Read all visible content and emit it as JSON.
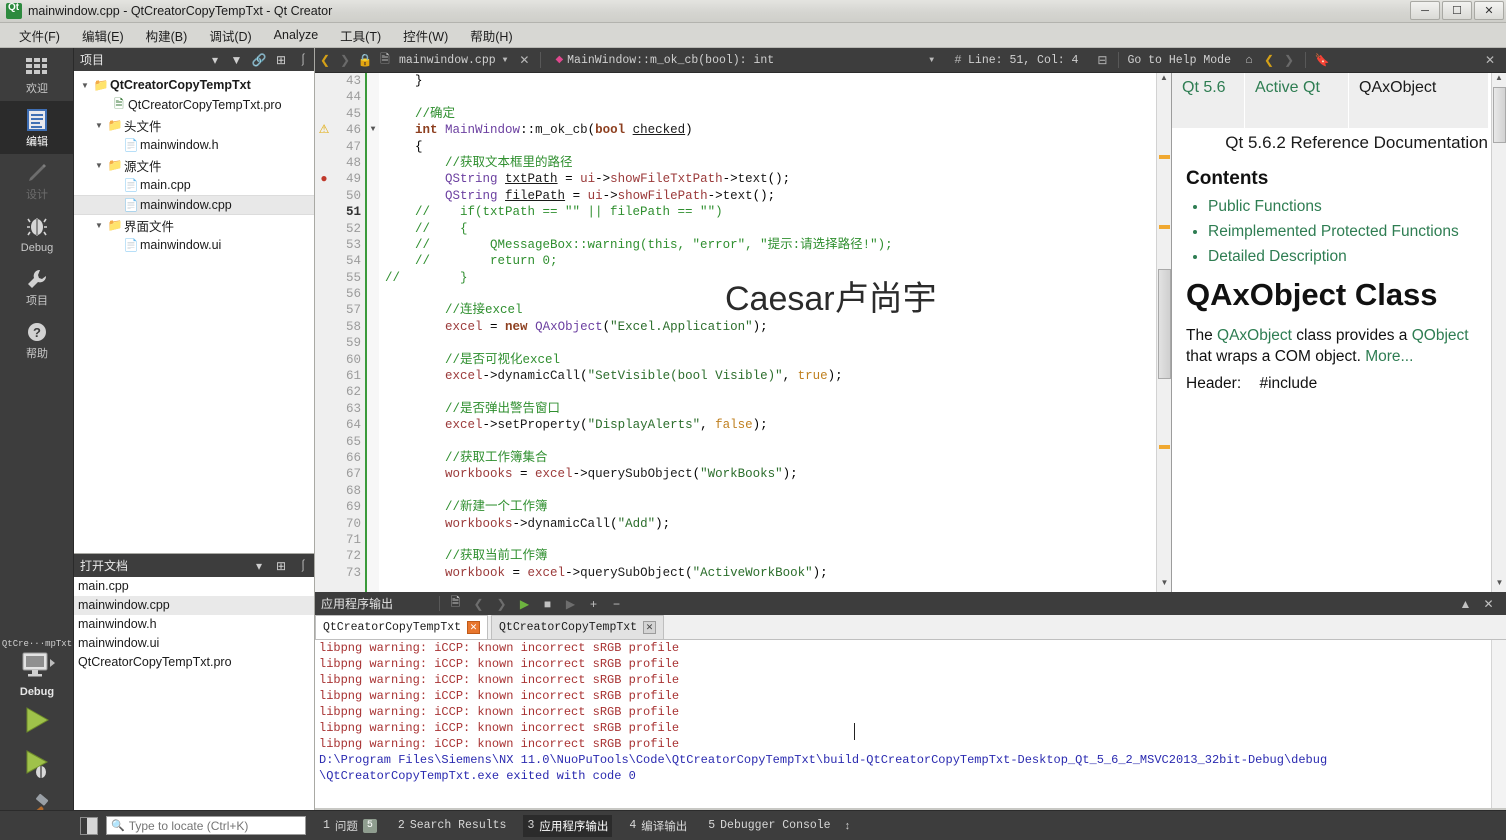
{
  "window": {
    "title": "mainwindow.cpp - QtCreatorCopyTempTxt - Qt Creator",
    "app_icon": "qt-logo-icon",
    "minimize_label": "–",
    "maximize_label": "❐",
    "close_label": "✕"
  },
  "menubar": {
    "items": [
      {
        "label": "文件(F)"
      },
      {
        "label": "编辑(E)"
      },
      {
        "label": "构建(B)"
      },
      {
        "label": "调试(D)"
      },
      {
        "label": "Analyze"
      },
      {
        "label": "工具(T)"
      },
      {
        "label": "控件(W)"
      },
      {
        "label": "帮助(H)"
      }
    ]
  },
  "modebar": {
    "items": [
      {
        "label": "欢迎",
        "icon": "welcome-grid-icon",
        "state": "normal"
      },
      {
        "label": "编辑",
        "icon": "edit-document-icon",
        "state": "selected"
      },
      {
        "label": "设计",
        "icon": "design-pencil-icon",
        "state": "disabled"
      },
      {
        "label": "Debug",
        "icon": "debug-bug-icon",
        "state": "normal"
      },
      {
        "label": "项目",
        "icon": "projects-wrench-icon",
        "state": "normal"
      },
      {
        "label": "帮助",
        "icon": "help-question-icon",
        "state": "normal"
      }
    ],
    "run_section": {
      "kit_name": "QtCre···mpTxt",
      "kit_config": "Debug",
      "kit_icon": "desktop-monitor-icon",
      "run_icon": "run-play-icon",
      "debug_icon": "debug-play-icon",
      "build_icon": "build-hammer-icon"
    }
  },
  "projects_panel": {
    "title": "项目",
    "header_icons": [
      "chevron-down-icon",
      "filter-icon",
      "link-sync-icon",
      "split-icon",
      "close-panel-icon"
    ],
    "tree": [
      {
        "label": "QtCreatorCopyTempTxt",
        "depth": 0,
        "arrow": "open",
        "icon": "project-folder-icon",
        "bold": true,
        "selected": false
      },
      {
        "label": "QtCreatorCopyTempTxt.pro",
        "depth": 1,
        "arrow": "none",
        "icon": "pro-file-icon",
        "bold": false,
        "selected": false
      },
      {
        "label": "头文件",
        "depth": 1,
        "arrow": "open",
        "icon": "header-folder-icon",
        "bold": false,
        "selected": false
      },
      {
        "label": "mainwindow.h",
        "depth": 2,
        "arrow": "none",
        "icon": "file-icon",
        "bold": false,
        "selected": false
      },
      {
        "label": "源文件",
        "depth": 1,
        "arrow": "open",
        "icon": "source-folder-icon",
        "bold": false,
        "selected": false
      },
      {
        "label": "main.cpp",
        "depth": 2,
        "arrow": "none",
        "icon": "file-icon",
        "bold": false,
        "selected": false
      },
      {
        "label": "mainwindow.cpp",
        "depth": 2,
        "arrow": "none",
        "icon": "file-icon",
        "bold": false,
        "selected": true
      },
      {
        "label": "界面文件",
        "depth": 1,
        "arrow": "open",
        "icon": "ui-folder-icon",
        "bold": false,
        "selected": false
      },
      {
        "label": "mainwindow.ui",
        "depth": 2,
        "arrow": "none",
        "icon": "ui-file-icon",
        "bold": false,
        "selected": false
      }
    ]
  },
  "open_documents": {
    "title": "打开文档",
    "header_icons": [
      "chevron-down-icon",
      "split-icon",
      "close-panel-icon"
    ],
    "items": [
      {
        "label": "main.cpp",
        "selected": false
      },
      {
        "label": "mainwindow.cpp",
        "selected": true
      },
      {
        "label": "mainwindow.h",
        "selected": false
      },
      {
        "label": "mainwindow.ui",
        "selected": false
      },
      {
        "label": "QtCreatorCopyTempTxt.pro",
        "selected": false
      }
    ]
  },
  "editor_toolbar": {
    "back_icon": "back-arrow-icon",
    "forward_icon": "forward-arrow-icon",
    "lock_icon": "lock-icon",
    "file_icon": "document-icon",
    "file_name": "mainwindow.cpp",
    "file_dropdown_icon": "chevron-down-icon",
    "file_close_icon": "close-icon",
    "symbol_icon": "method-diamond-icon",
    "symbol_name": "MainWindow::m_ok_cb(bool): int",
    "symbol_dropdown_icon": "chevron-down-icon",
    "line_col_icon": "hash-icon",
    "line_col": "Line: 51, Col: 4",
    "split_icon": "split-editor-icon",
    "help_mode_label": "Go to Help Mode",
    "help_home_icon": "home-icon",
    "help_back_icon": "help-back-icon",
    "help_forward_icon": "help-forward-icon",
    "bookmark_icon": "bookmark-icon",
    "panel_close_icon": "close-icon"
  },
  "editor": {
    "current_line": 51,
    "watermark": "Caesar卢尚宇",
    "lines": [
      {
        "n": 43,
        "mark": "",
        "fold": "",
        "html": "    }"
      },
      {
        "n": 44,
        "mark": "",
        "fold": "",
        "html": ""
      },
      {
        "n": 45,
        "mark": "",
        "fold": "",
        "html": "    <s class='c-cmt'>//确定</s>"
      },
      {
        "n": 46,
        "mark": "warning",
        "fold": "open",
        "html": "    <s class='c-kw'>int</s> <s class='c-type'>MainWindow</s>::<s class='c-id'>m_ok_cb</s>(<s class='c-kw'>bool</s> <s class='c-id c-ul'>checked</s>)"
      },
      {
        "n": 47,
        "mark": "",
        "fold": "",
        "html": "    {"
      },
      {
        "n": 48,
        "mark": "",
        "fold": "",
        "html": "        <s class='c-cmt'>//获取文本框里的路径</s>"
      },
      {
        "n": 49,
        "mark": "bookmark",
        "fold": "",
        "html": "        <s class='c-type'>QString</s> <s class='c-id c-ul'>txtPath</s> = <s class='c-var'>ui</s>-&gt;<s class='c-var'>showFileTxtPath</s>-&gt;<s class='c-id'>text</s>();"
      },
      {
        "n": 50,
        "mark": "",
        "fold": "",
        "html": "        <s class='c-type'>QString</s> <s class='c-id c-ul'>filePath</s> = <s class='c-var'>ui</s>-&gt;<s class='c-var'>showFilePath</s>-&gt;<s class='c-id'>text</s>();"
      },
      {
        "n": 51,
        "mark": "",
        "fold": "",
        "html": "    <s class='c-cmt'>//    if(txtPath == \"\" || filePath == \"\")</s>"
      },
      {
        "n": 52,
        "mark": "",
        "fold": "",
        "html": "    <s class='c-cmt'>//    {</s>"
      },
      {
        "n": 53,
        "mark": "",
        "fold": "",
        "html": "    <s class='c-cmt'>//        QMessageBox::warning(this, \"error\", \"提示:请选择路径!\");</s>"
      },
      {
        "n": 54,
        "mark": "",
        "fold": "",
        "html": "    <s class='c-cmt'>//        return 0;</s>"
      },
      {
        "n": 55,
        "mark": "",
        "fold": "",
        "html": "<s class='c-cmt'>//        }</s>"
      },
      {
        "n": 56,
        "mark": "",
        "fold": "",
        "html": ""
      },
      {
        "n": 57,
        "mark": "",
        "fold": "",
        "html": "        <s class='c-cmt'>//连接excel</s>"
      },
      {
        "n": 58,
        "mark": "",
        "fold": "",
        "html": "        <s class='c-var'>excel</s> = <s class='c-kw'>new</s> <s class='c-type'>QAxObject</s>(<s class='c-str'>\"Excel.Application\"</s>);"
      },
      {
        "n": 59,
        "mark": "",
        "fold": "",
        "html": ""
      },
      {
        "n": 60,
        "mark": "",
        "fold": "",
        "html": "        <s class='c-cmt'>//是否可视化excel</s>"
      },
      {
        "n": 61,
        "mark": "",
        "fold": "",
        "html": "        <s class='c-var'>excel</s>-&gt;<s class='c-id'>dynamicCall</s>(<s class='c-str'>\"SetVisible(bool Visible)\"</s>, <s class='c-num'>true</s>);"
      },
      {
        "n": 62,
        "mark": "",
        "fold": "",
        "html": ""
      },
      {
        "n": 63,
        "mark": "",
        "fold": "",
        "html": "        <s class='c-cmt'>//是否弹出警告窗口</s>"
      },
      {
        "n": 64,
        "mark": "",
        "fold": "",
        "html": "        <s class='c-var'>excel</s>-&gt;<s class='c-id'>setProperty</s>(<s class='c-str'>\"DisplayAlerts\"</s>, <s class='c-num'>false</s>);"
      },
      {
        "n": 65,
        "mark": "",
        "fold": "",
        "html": ""
      },
      {
        "n": 66,
        "mark": "",
        "fold": "",
        "html": "        <s class='c-cmt'>//获取工作簿集合</s>"
      },
      {
        "n": 67,
        "mark": "",
        "fold": "",
        "html": "        <s class='c-var'>workbooks</s> = <s class='c-var'>excel</s>-&gt;<s class='c-id'>querySubObject</s>(<s class='c-str'>\"WorkBooks\"</s>);"
      },
      {
        "n": 68,
        "mark": "",
        "fold": "",
        "html": ""
      },
      {
        "n": 69,
        "mark": "",
        "fold": "",
        "html": "        <s class='c-cmt'>//新建一个工作簿</s>"
      },
      {
        "n": 70,
        "mark": "",
        "fold": "",
        "html": "        <s class='c-var'>workbooks</s>-&gt;<s class='c-id'>dynamicCall</s>(<s class='c-str'>\"Add\"</s>);"
      },
      {
        "n": 71,
        "mark": "",
        "fold": "",
        "html": ""
      },
      {
        "n": 72,
        "mark": "",
        "fold": "",
        "html": "        <s class='c-cmt'>//获取当前工作簿</s>"
      },
      {
        "n": 73,
        "mark": "",
        "fold": "",
        "html": "        <s class='c-var'>workbook</s> = <s class='c-var'>excel</s>-&gt;<s class='c-id'>querySubObject</s>(<s class='c-str'>\"ActiveWorkBook\"</s>);"
      }
    ]
  },
  "help_panel": {
    "breadcrumbs": [
      {
        "label": "Qt 5.6",
        "active": false
      },
      {
        "label": "Active Qt",
        "active": false
      },
      {
        "label": "QAxObject",
        "active": true
      }
    ],
    "subtitle": "Qt 5.6.2 Reference Documentation",
    "contents_heading": "Contents",
    "contents": [
      "Public Functions",
      "Reimplemented Protected Functions",
      "Detailed Description"
    ],
    "class_title": "QAxObject Class",
    "description_prefix": "The ",
    "description_link1": "QAxObject",
    "description_mid": " class provides a ",
    "description_link2": "QObject",
    "description_suffix": " that wraps a COM object. ",
    "description_more": "More...",
    "header_label": "Header:",
    "header_value": "#include"
  },
  "output_pane": {
    "title": "应用程序输出",
    "icons": [
      "open-in-editor-icon",
      "prev-item-icon",
      "next-item-icon",
      "run-icon",
      "stop-icon",
      "attach-icon",
      "zoom-in-icon",
      "zoom-out-icon"
    ],
    "minimize_icon": "chevron-up-icon",
    "close_icon": "close-icon",
    "tabs": [
      {
        "label": "QtCreatorCopyTempTxt",
        "active": true,
        "close_hot": true
      },
      {
        "label": "QtCreatorCopyTempTxt",
        "active": false,
        "close_hot": false
      }
    ],
    "lines": [
      {
        "text": "libpng warning: iCCP: known incorrect sRGB profile",
        "kind": "warn"
      },
      {
        "text": "libpng warning: iCCP: known incorrect sRGB profile",
        "kind": "warn"
      },
      {
        "text": "libpng warning: iCCP: known incorrect sRGB profile",
        "kind": "warn"
      },
      {
        "text": "libpng warning: iCCP: known incorrect sRGB profile",
        "kind": "warn"
      },
      {
        "text": "libpng warning: iCCP: known incorrect sRGB profile",
        "kind": "warn"
      },
      {
        "text": "libpng warning: iCCP: known incorrect sRGB profile",
        "kind": "warn"
      },
      {
        "text": "libpng warning: iCCP: known incorrect sRGB profile",
        "kind": "warn"
      },
      {
        "text": "D:\\Program Files\\Siemens\\NX 11.0\\NuoPuTools\\Code\\QtCreatorCopyTempTxt\\build-QtCreatorCopyTempTxt-Desktop_Qt_5_6_2_MSVC2013_32bit-Debug\\debug",
        "kind": "path"
      },
      {
        "text": "\\QtCreatorCopyTempTxt.exe exited with code 0",
        "kind": "path"
      }
    ]
  },
  "statusbar": {
    "toggle_sidebar_icon": "toggle-sidebar-icon",
    "locator_placeholder": "Type to locate (Ctrl+K)",
    "locator_value": "",
    "search_icon": "search-icon",
    "tabs": [
      {
        "num": "1",
        "label": "问题",
        "badge": "5",
        "active": false
      },
      {
        "num": "2",
        "label": "Search Results",
        "badge": "",
        "active": false
      },
      {
        "num": "3",
        "label": "应用程序输出",
        "badge": "",
        "active": true
      },
      {
        "num": "4",
        "label": "编译输出",
        "badge": "",
        "active": false
      },
      {
        "num": "5",
        "label": "Debugger Console",
        "badge": "",
        "active": false
      }
    ],
    "spinner_icon": "updown-arrows-icon"
  },
  "colors": {
    "accent_green": "#2e7d52",
    "chrome_dark": "#3d3d3d",
    "selected_dark": "#2b2b2b",
    "warn_red": "#a83232",
    "path_blue": "#2a2ab0",
    "current_line_marker": "#3a9a3a"
  }
}
